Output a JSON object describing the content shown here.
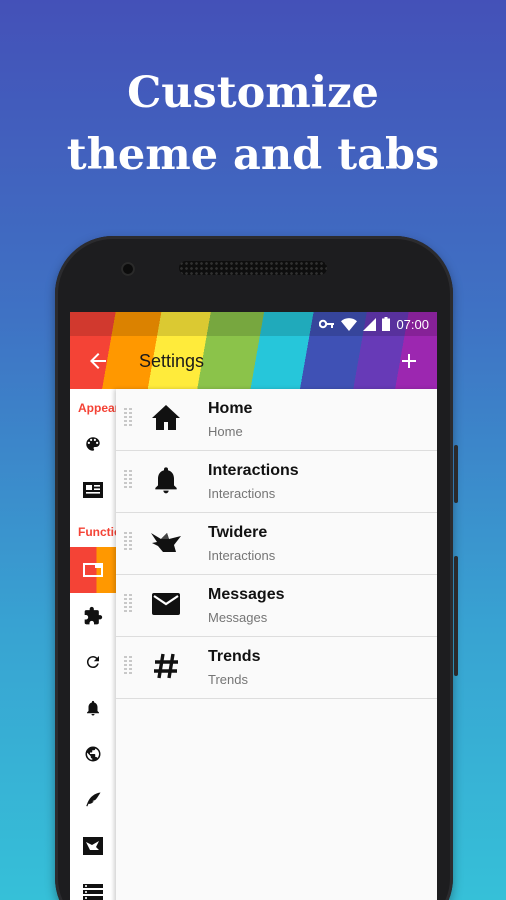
{
  "headline": {
    "line1": "Customize",
    "line2": "theme and tabs"
  },
  "status_bar": {
    "time": "07:00",
    "icons": [
      "vpn-key-icon",
      "wifi-icon",
      "signal-icon",
      "battery-icon"
    ]
  },
  "app_bar": {
    "title": "Settings",
    "back_icon": "arrow-back-icon",
    "add_icon": "plus-icon"
  },
  "sidebar": {
    "sections": [
      {
        "header": "Appearance"
      },
      {
        "header": "Functions"
      }
    ],
    "items": [
      {
        "icon": "palette-icon"
      },
      {
        "icon": "card-icon"
      },
      {
        "icon": "tabs-icon",
        "active": true
      },
      {
        "icon": "extension-icon"
      },
      {
        "icon": "refresh-icon"
      },
      {
        "icon": "bell-icon"
      },
      {
        "icon": "globe-icon"
      },
      {
        "icon": "feather-icon"
      },
      {
        "icon": "twidere-icon"
      },
      {
        "icon": "storage-icon"
      }
    ]
  },
  "tabs": [
    {
      "title": "Home",
      "subtitle": "Home",
      "icon": "home-icon"
    },
    {
      "title": "Interactions",
      "subtitle": "Interactions",
      "icon": "bell-icon"
    },
    {
      "title": "Twidere",
      "subtitle": "Interactions",
      "icon": "twidere-bird-icon"
    },
    {
      "title": "Messages",
      "subtitle": "Messages",
      "icon": "envelope-icon"
    },
    {
      "title": "Trends",
      "subtitle": "Trends",
      "icon": "hashtag-icon"
    }
  ],
  "colors": {
    "background_top": "#4451b8",
    "background_bottom": "#36c0d8",
    "accent": "#f44336",
    "rainbow": [
      "#f44336",
      "#ff9800",
      "#ffeb3b",
      "#8bc34a",
      "#26c6da",
      "#3f51b5",
      "#673ab7",
      "#9c27b0"
    ]
  }
}
